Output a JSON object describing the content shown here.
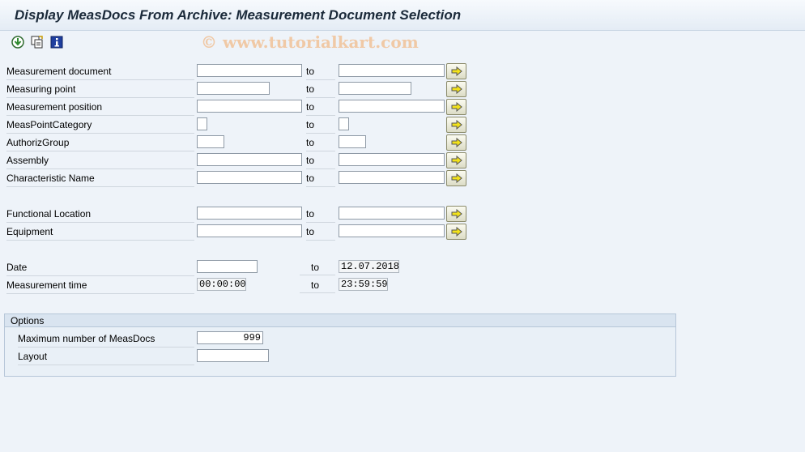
{
  "title": "Display MeasDocs From Archive: Measurement Document Selection",
  "watermark": "© www.tutorialkart.com",
  "toolbar": {
    "icons": [
      "execute-icon",
      "get-variant-icon",
      "program-info-icon"
    ]
  },
  "to_label": "to",
  "fields": {
    "meas_doc": {
      "label": "Measurement document",
      "from": "",
      "to": ""
    },
    "meas_point": {
      "label": "Measuring point",
      "from": "",
      "to": ""
    },
    "meas_position": {
      "label": "Measurement position",
      "from": "",
      "to": ""
    },
    "meas_point_category": {
      "label": "MeasPointCategory",
      "from": "",
      "to": ""
    },
    "authoriz_group": {
      "label": "AuthorizGroup",
      "from": "",
      "to": ""
    },
    "assembly": {
      "label": "Assembly",
      "from": "",
      "to": ""
    },
    "characteristic_name": {
      "label": "Characteristic Name",
      "from": "",
      "to": ""
    },
    "functional_location": {
      "label": "Functional Location",
      "from": "",
      "to": ""
    },
    "equipment": {
      "label": "Equipment",
      "from": "",
      "to": ""
    },
    "date": {
      "label": "Date",
      "from": "",
      "to": "12.07.2018"
    },
    "meas_time": {
      "label": "Measurement time",
      "from": "00:00:00",
      "to": "23:59:59"
    }
  },
  "options": {
    "title": "Options",
    "max_docs": {
      "label": "Maximum number of MeasDocs",
      "value": "999"
    },
    "layout": {
      "label": "Layout",
      "value": ""
    }
  },
  "colors": {
    "multiple_selection_arrow": "#f2e21a",
    "title_text": "#1b2a3a"
  }
}
